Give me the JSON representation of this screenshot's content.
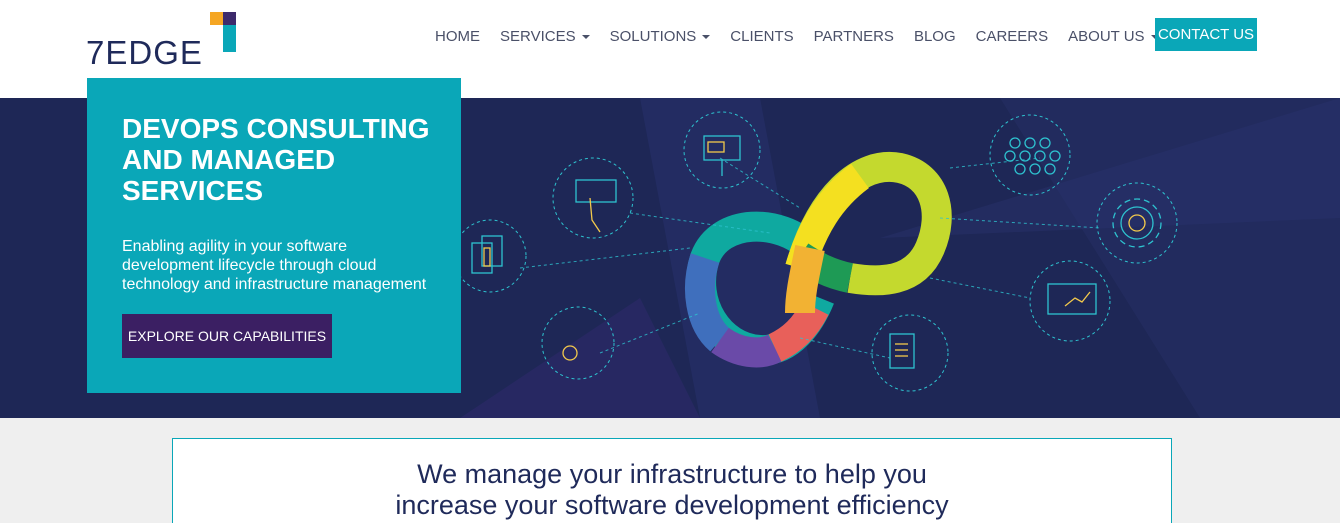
{
  "logo": {
    "text": "7EDGE"
  },
  "nav": {
    "items": [
      {
        "label": "HOME",
        "dropdown": false
      },
      {
        "label": "SERVICES",
        "dropdown": true
      },
      {
        "label": "SOLUTIONS",
        "dropdown": true
      },
      {
        "label": "CLIENTS",
        "dropdown": false
      },
      {
        "label": "PARTNERS",
        "dropdown": false
      },
      {
        "label": "BLOG",
        "dropdown": false
      },
      {
        "label": "CAREERS",
        "dropdown": false
      },
      {
        "label": "ABOUT US",
        "dropdown": true
      }
    ],
    "contact_label": "CONTACT US"
  },
  "hero": {
    "title": "DEVOPS CONSULTING AND MANAGED SERVICES",
    "subtitle": "Enabling agility in your software development lifecycle through cloud technology and infrastructure management",
    "cta_label": "EXPLORE OUR CAPABILITIES"
  },
  "tagline": {
    "line1": "We manage your infrastructure to help you",
    "line2": "increase your software development efficiency"
  },
  "colors": {
    "teal": "#0aa7b8",
    "navy": "#1e2756",
    "purple_button": "#3b1f63",
    "logo_orange": "#f5a623"
  }
}
